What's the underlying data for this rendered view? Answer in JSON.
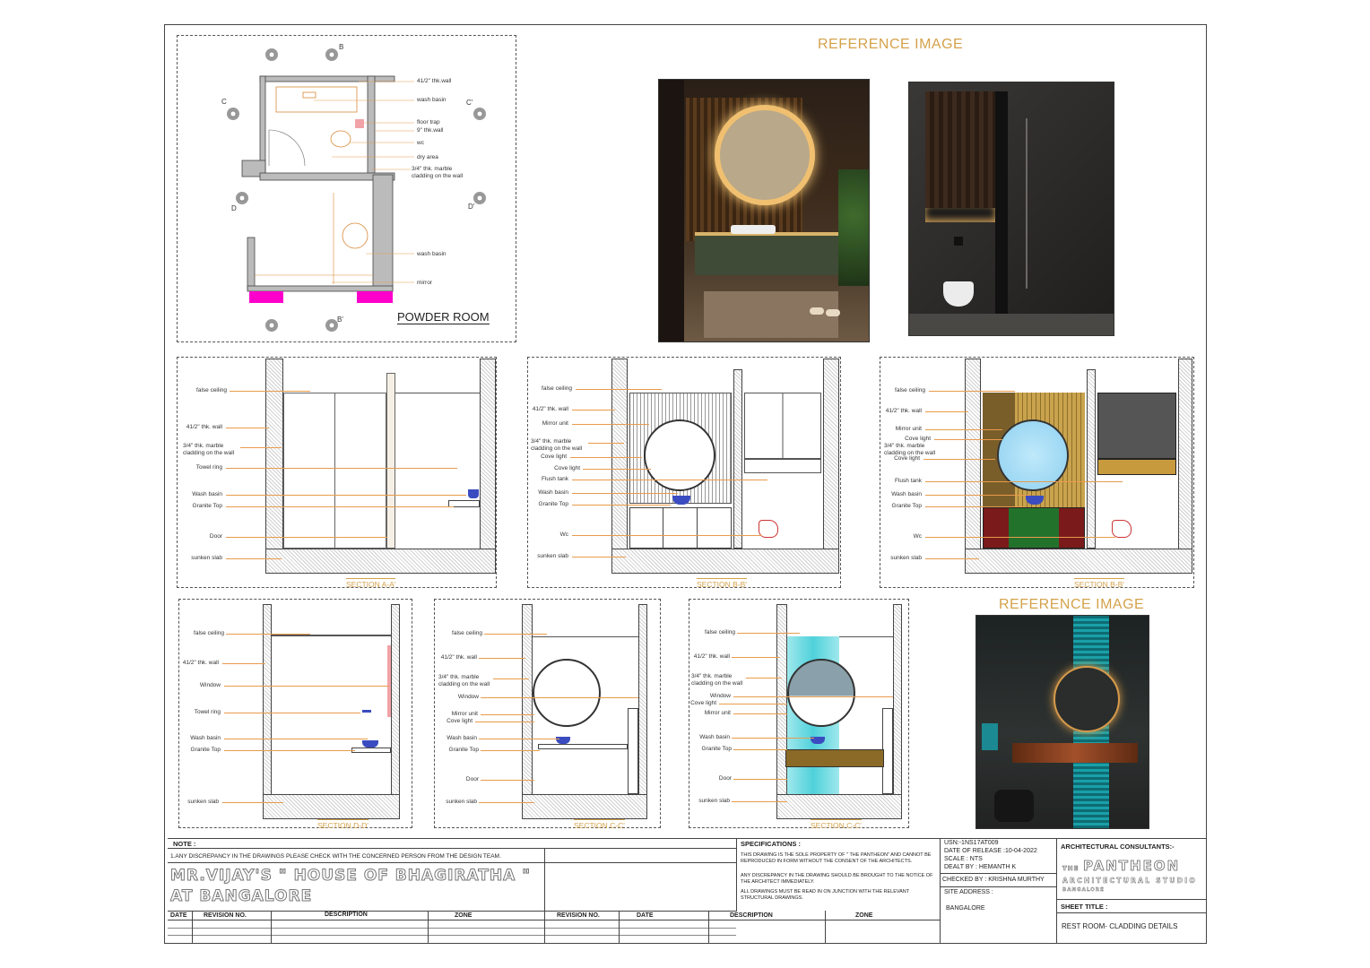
{
  "reference_title_1": "REFERENCE IMAGE",
  "reference_title_2": "REFERENCE IMAGE",
  "plan": {
    "title": "POWDER ROOM",
    "labels": [
      "41/2\" thk.wall",
      "wash basin",
      "floor trap",
      "9\" thk.wall",
      "wc",
      "dry area",
      "3/4\" thk. marble",
      "cladding on the wall",
      "wash basin",
      "mirror"
    ],
    "markers": [
      "B",
      "C",
      "C'",
      "D",
      "D'",
      "B'"
    ]
  },
  "sections": {
    "aa": {
      "caption": "SECTION A-A'",
      "labels": [
        "false ceiling",
        "41/2\" thk. wall",
        "3/4\" thk. marble",
        "cladding on the wall",
        "Towel ring",
        "Wash basin",
        "Granite Top",
        "Door",
        "sunken slab"
      ]
    },
    "bb1": {
      "caption": "SECTION B-B'",
      "labels": [
        "false ceiling",
        "41/2\" thk. wall",
        "Mirror unit",
        "3/4\" thk. marble",
        "cladding on the wall",
        "Cove light",
        "Cove light",
        "Flush tank",
        "Wash basin",
        "Granite Top",
        "Wc",
        "sunken slab"
      ]
    },
    "bb2": {
      "caption": "SECTION B-B'",
      "labels": [
        "false ceiling",
        "41/2\" thk. wall",
        "Mirror unit",
        "Cove light",
        "3/4\" thk. marble",
        "cladding on the wall",
        "Cove light",
        "Flush tank",
        "Wash basin",
        "Granite Top",
        "Wc",
        "sunken slab"
      ]
    },
    "dd": {
      "caption": "SECTION D-D'",
      "labels": [
        "false ceiling",
        "41/2\" thk. wall",
        "Window",
        "Towel ring",
        "Wash basin",
        "Granite Top",
        "sunken slab"
      ]
    },
    "cc1": {
      "caption": "SECTION C-C'",
      "labels": [
        "false ceiling",
        "41/2\" thk. wall",
        "3/4\" thk. marble",
        "cladding on the wall",
        "Window",
        "Mirror unit",
        "Cove light",
        "Wash basin",
        "Granite Top",
        "Door",
        "sunken slab"
      ]
    },
    "cc2": {
      "caption": "SECTION C-C'",
      "labels": [
        "false ceiling",
        "41/2\" thk. wall",
        "3/4\" thk. marble",
        "cladding on the wall",
        "Window",
        "Cove light",
        "Mirror unit",
        "Wash basin",
        "Granite Top",
        "Door",
        "sunken slab"
      ]
    }
  },
  "titleblock": {
    "note_label": "NOTE :",
    "note_text": "1.ANY DISCREPANCY IN THE DRAWINGS PLEASE CHECK WITH THE CONCERNED PERSON FROM THE DESIGN TEAM.",
    "project_line1": "MR.VIJAY'S \" HOUSE OF BHAGIRATHA \"",
    "project_line2": "AT BANGALORE",
    "rev_headers": [
      "DATE",
      "REVISION NO.",
      "DESCRIPTION",
      "ZONE",
      "REVISION NO.",
      "DATE",
      "DESCRIPTION",
      "ZONE"
    ],
    "spec_label": "SPECIFICATIONS :",
    "spec_1": "THIS DRAWING IS THE SOLE PROPERTY OF \" THE PANTHEON\" AND CANNOT BE REPRODUCED IN FORM WITHOUT THE CONSENT OF THE ARCHITECTS.",
    "spec_2": "ANY DISCREPANCY IN THE DRAWING SHOULD BE BROUGHT TO THE NOTICE OF THE ARCHITECT IMMEDIATELY.",
    "spec_3": "ALL DRAWINGS MUST BE READ IN ON JUNCTION WITH THE RELEVANT STRUCTURAL DRAWINGS.",
    "usn": "USN:-1NS17AT009",
    "release": "DATE OF RELEASE :10-04-2022",
    "scale": "SCALE : NTS",
    "dealt": "DEALT BY : HEMANTH K",
    "checked": "CHECKED BY : KRISHNA MURTHY",
    "site_label": "SITE ADDRESS :",
    "site_value": "BANGALORE",
    "consultants_label": "ARCHITECTURAL CONSULTANTS:-",
    "firm_the": "THE",
    "firm_name": "PANTHEON",
    "firm_sub": "ARCHITECTURAL STUDIO",
    "firm_city": "BANGALORE",
    "sheet_title_label": "SHEET TITLE :",
    "sheet_title": "REST ROOM- CLADDING DETAILS"
  }
}
